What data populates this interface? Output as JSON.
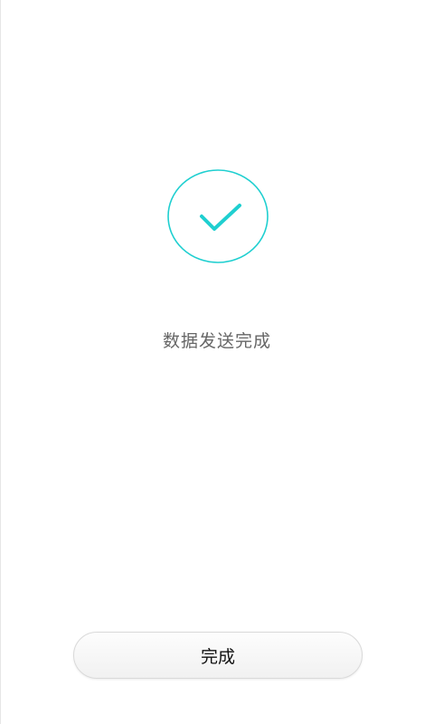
{
  "status": {
    "message": "数据发送完成"
  },
  "actions": {
    "done_label": "完成"
  },
  "icons": {
    "success": "check-circle-icon"
  },
  "colors": {
    "accent": "#1fcfd0",
    "text_secondary": "#666666",
    "button_text": "#111111",
    "button_border": "#d9d9d9",
    "background": "#ffffff"
  }
}
